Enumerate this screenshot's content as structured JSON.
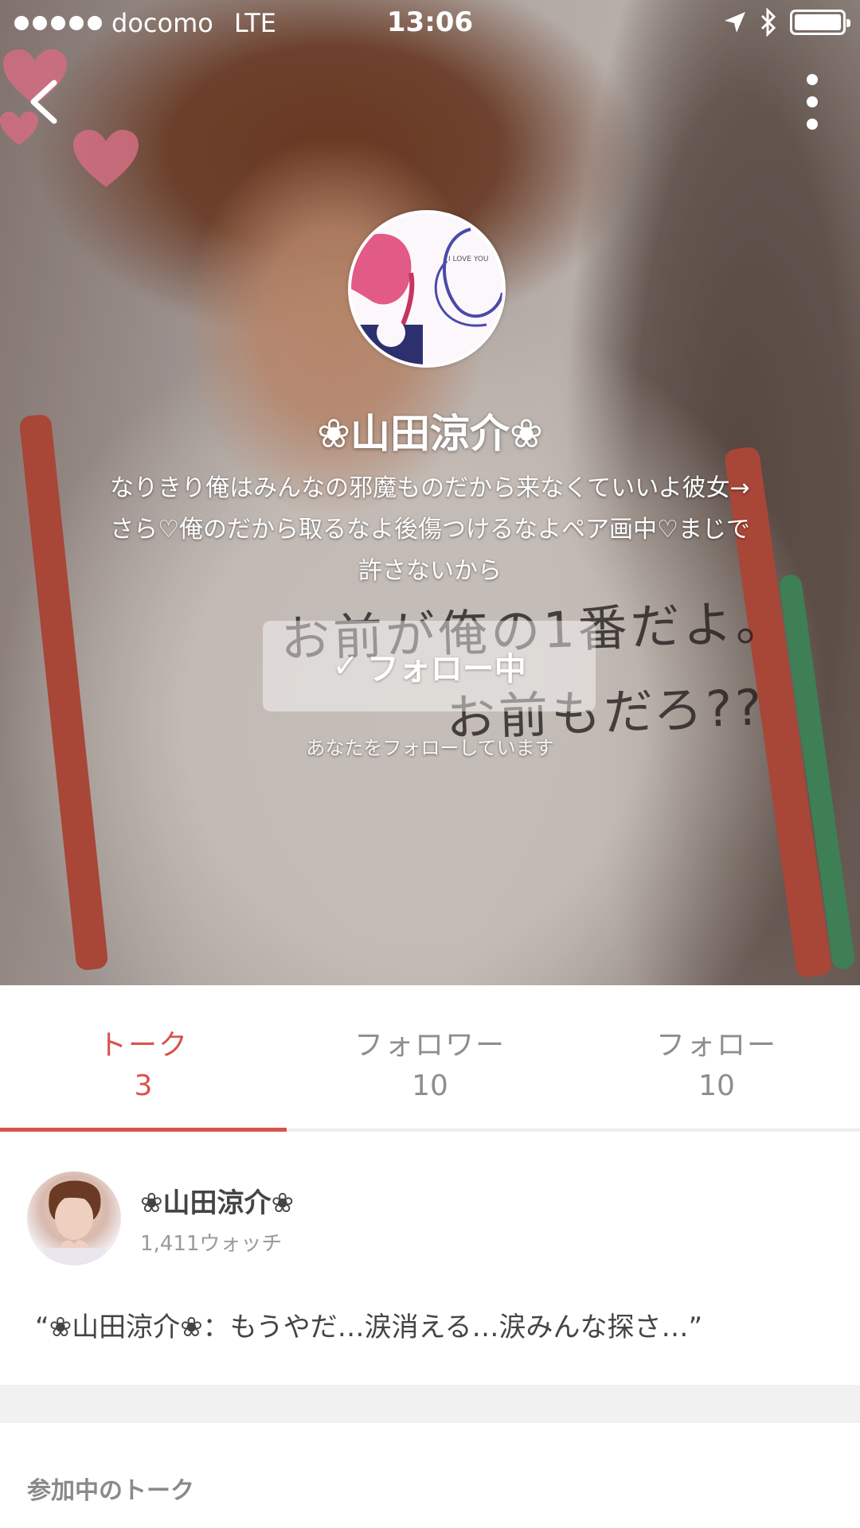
{
  "status_bar": {
    "carrier": "docomo",
    "network": "LTE",
    "time": "13:06",
    "battery_level": 1.0
  },
  "nav": {
    "back_icon": "chevron-left-icon",
    "more_icon": "vertical-dots-icon"
  },
  "profile": {
    "name": "❀山田涼介❀",
    "bio": "なりきり俺はみんなの邪魔ものだから来なくていいよ彼女→さら♡俺のだから取るなよ後傷つけるなよペア画中♡まじで許さないから",
    "follow_check": "✓",
    "follow_label": "フォロー中",
    "follows_you": "あなたをフォローしています",
    "avatar_text": "I LOVE YOU",
    "photo_text_line1": "お前が俺の1番だよ。",
    "photo_text_line2": "お前もだろ??"
  },
  "tabs": [
    {
      "label": "トーク",
      "count": "3",
      "active": true
    },
    {
      "label": "フォロワー",
      "count": "10",
      "active": false
    },
    {
      "label": "フォロー",
      "count": "10",
      "active": false
    }
  ],
  "talk": {
    "title": "❀山田涼介❀",
    "watch_count": "1,411ウォッチ",
    "quote": "“❀山田涼介❀：もうやだ…涙消える…涙みんな探さ…”"
  },
  "section": {
    "joined_talks_title": "参加中のトーク"
  },
  "colors": {
    "accent": "#d9534b",
    "tab_inactive": "#8e8e8e",
    "divider_band": "#f1f1f1"
  }
}
